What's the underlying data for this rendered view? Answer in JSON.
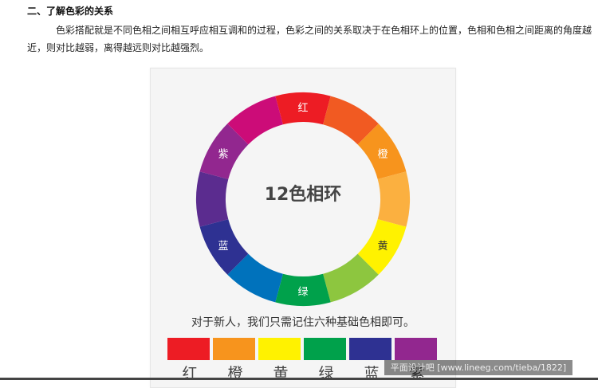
{
  "article": {
    "heading": "二、了解色彩的关系",
    "paragraph": "色彩搭配就是不同色相之间相互呼应相互调和的过程，色彩之间的关系取决于在色相环上的位置，色相和色相之间距离的角度越近，则对比越弱，离得越远则对比越强烈。"
  },
  "color_wheel": {
    "title": "12色相环",
    "segments": [
      {
        "color": "#ED1C24",
        "label": "红"
      },
      {
        "color": "#F15A22",
        "label": ""
      },
      {
        "color": "#F7941D",
        "label": "橙"
      },
      {
        "color": "#FBB040",
        "label": ""
      },
      {
        "color": "#FFF200",
        "label": "黄"
      },
      {
        "color": "#8DC63F",
        "label": ""
      },
      {
        "color": "#00A14B",
        "label": "绿"
      },
      {
        "color": "#0072BC",
        "label": ""
      },
      {
        "color": "#2E3192",
        "label": "蓝"
      },
      {
        "color": "#5B2C8F",
        "label": ""
      },
      {
        "color": "#92278F",
        "label": "紫"
      },
      {
        "color": "#CC0C78",
        "label": ""
      }
    ]
  },
  "caption": "对于新人，我们只需记住六种基础色相即可。",
  "basic_colors": [
    {
      "color": "#ED1C24",
      "label": "红"
    },
    {
      "color": "#F7941D",
      "label": "橙"
    },
    {
      "color": "#FFF200",
      "label": "黄"
    },
    {
      "color": "#00A14B",
      "label": "绿"
    },
    {
      "color": "#2E3192",
      "label": "蓝"
    },
    {
      "color": "#92278F",
      "label": "紫"
    }
  ],
  "watermark": "平面设计吧 [www.lineeg.com/tieba/1822]"
}
